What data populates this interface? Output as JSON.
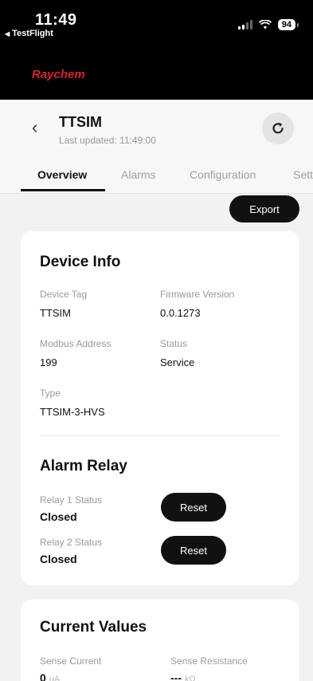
{
  "status_bar": {
    "time": "11:49",
    "back_app": "TestFlight",
    "battery": "94"
  },
  "brand": {
    "name": "Raychem",
    "color": "#d2232a"
  },
  "device_header": {
    "back_icon": "chevron-left-icon",
    "name": "TTSIM",
    "last_updated": "Last updated: 11:49:00",
    "refresh_icon": "refresh-icon"
  },
  "tabs": [
    {
      "label": "Overview",
      "active": true
    },
    {
      "label": "Alarms",
      "active": false
    },
    {
      "label": "Configuration",
      "active": false
    },
    {
      "label": "Settings",
      "active": false
    }
  ],
  "export_label": "Export",
  "device_info": {
    "title": "Device Info",
    "fields": [
      {
        "label": "Device Tag",
        "value": "TTSIM"
      },
      {
        "label": "Firmware Version",
        "value": "0.0.1273"
      },
      {
        "label": "Modbus Address",
        "value": "199"
      },
      {
        "label": "Status",
        "value": "Service"
      },
      {
        "label": "Type",
        "value": "TTSIM-3-HVS"
      }
    ]
  },
  "alarm_relay": {
    "title": "Alarm Relay",
    "relays": [
      {
        "label": "Relay 1 Status",
        "value": "Closed",
        "button": "Reset"
      },
      {
        "label": "Relay 2 Status",
        "value": "Closed",
        "button": "Reset"
      }
    ]
  },
  "current_values": {
    "title": "Current Values",
    "items": [
      {
        "label": "Sense Current",
        "value": "0",
        "unit": "uA"
      },
      {
        "label": "Sense Resistance",
        "value": "---",
        "unit": "kΩ"
      }
    ]
  }
}
